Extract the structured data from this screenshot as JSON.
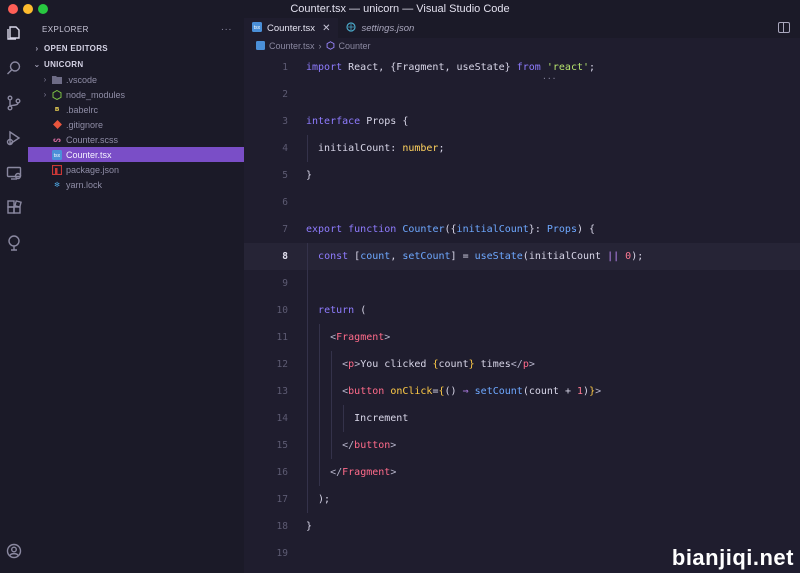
{
  "window": {
    "title": "Counter.tsx — unicorn — Visual Studio Code"
  },
  "sidebar": {
    "title": "EXPLORER",
    "more": "···",
    "sections": {
      "open_editors": "OPEN EDITORS",
      "project": "UNICORN"
    },
    "items": [
      {
        "label": ".vscode",
        "icon": "folder-icon"
      },
      {
        "label": "node_modules",
        "icon": "node-folder-icon"
      },
      {
        "label": ".babelrc",
        "icon": "babel-icon"
      },
      {
        "label": ".gitignore",
        "icon": "git-icon"
      },
      {
        "label": "Counter.scss",
        "icon": "sass-icon"
      },
      {
        "label": "Counter.tsx",
        "icon": "tsx-icon",
        "selected": true
      },
      {
        "label": "package.json",
        "icon": "npm-icon"
      },
      {
        "label": "yarn.lock",
        "icon": "yarn-icon"
      }
    ]
  },
  "tabs": [
    {
      "label": "Counter.tsx",
      "active": true
    },
    {
      "label": "settings.json",
      "active": false
    }
  ],
  "breadcrumb": {
    "file": "Counter.tsx",
    "symbol": "Counter"
  },
  "editor": {
    "current_line": 8,
    "lines": [
      "1",
      "2",
      "3",
      "4",
      "5",
      "6",
      "7",
      "8",
      "9",
      "10",
      "11",
      "12",
      "13",
      "14",
      "15",
      "16",
      "17",
      "18",
      "19"
    ]
  },
  "colors": {
    "accent": "#7a4ec7",
    "background": "#1f1d2e",
    "sidebar": "#1b1a28"
  },
  "watermark": "bianjiqi.net"
}
